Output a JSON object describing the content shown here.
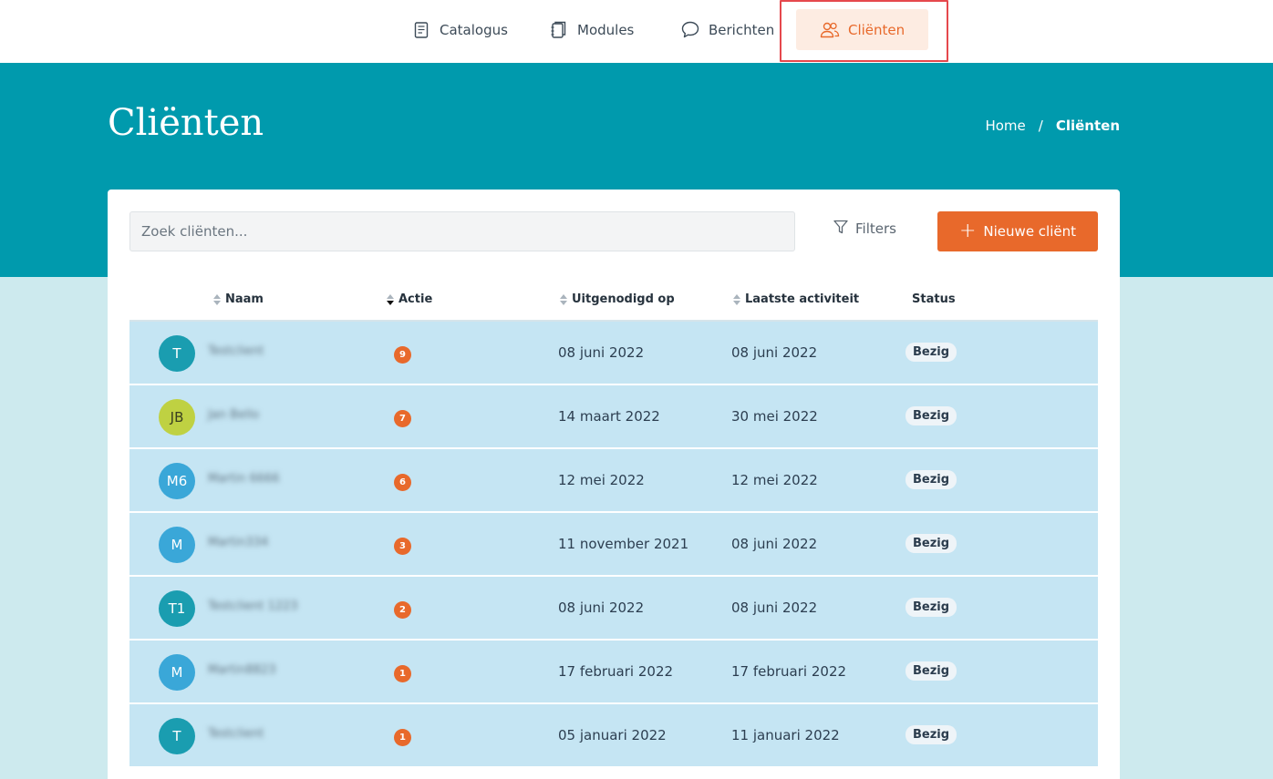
{
  "nav": {
    "items": [
      {
        "label": "Catalogus",
        "icon": "catalog-icon"
      },
      {
        "label": "Modules",
        "icon": "modules-icon"
      },
      {
        "label": "Berichten",
        "icon": "chat-icon"
      },
      {
        "label": "Cliënten",
        "icon": "users-icon",
        "active": true
      }
    ]
  },
  "header": {
    "title": "Cliënten",
    "breadcrumb": {
      "home": "Home",
      "separator": "/",
      "current": "Cliënten"
    }
  },
  "toolbar": {
    "search_placeholder": "Zoek cliënten...",
    "filters_label": "Filters",
    "new_client_label": "Nieuwe cliënt"
  },
  "table": {
    "columns": [
      "Naam",
      "Actie",
      "Uitgenodigd op",
      "Laatste activiteit",
      "Status"
    ],
    "rows": [
      {
        "initials": "T",
        "color": "teal",
        "name": "Testclient",
        "actions": "9",
        "invited": "08 juni 2022",
        "last_activity": "08 juni 2022",
        "status": "Bezig"
      },
      {
        "initials": "JB",
        "color": "lime",
        "name": "Jan Bello",
        "actions": "7",
        "invited": "14 maart 2022",
        "last_activity": "30 mei 2022",
        "status": "Bezig"
      },
      {
        "initials": "M6",
        "color": "blue",
        "name": "Martin 6666",
        "actions": "6",
        "invited": "12 mei 2022",
        "last_activity": "12 mei 2022",
        "status": "Bezig"
      },
      {
        "initials": "M",
        "color": "blue",
        "name": "Martin334",
        "actions": "3",
        "invited": "11 november 2021",
        "last_activity": "08 juni 2022",
        "status": "Bezig"
      },
      {
        "initials": "T1",
        "color": "teal",
        "name": "Testclient 1223",
        "actions": "2",
        "invited": "08 juni 2022",
        "last_activity": "08 juni 2022",
        "status": "Bezig"
      },
      {
        "initials": "M",
        "color": "blue",
        "name": "Martin8823",
        "actions": "1",
        "invited": "17 februari 2022",
        "last_activity": "17 februari 2022",
        "status": "Bezig"
      },
      {
        "initials": "T",
        "color": "teal",
        "name": "Testclient",
        "actions": "1",
        "invited": "05 januari 2022",
        "last_activity": "11 januari 2022",
        "status": "Bezig"
      }
    ]
  },
  "colors": {
    "accent": "#e8692b",
    "hero": "#009aad",
    "row_bg": "#c5e5f3"
  }
}
